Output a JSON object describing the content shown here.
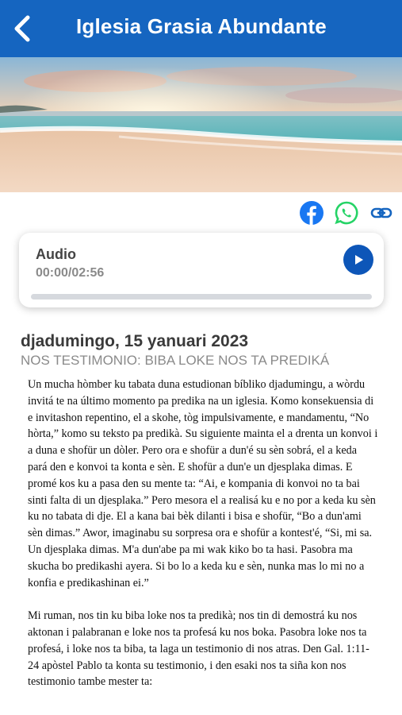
{
  "header": {
    "title": "Iglesia Grasia Abundante",
    "back_icon": "chevron-left-icon"
  },
  "share": {
    "icons": [
      "facebook-icon",
      "whatsapp-icon",
      "link-icon"
    ]
  },
  "audio": {
    "label": "Audio",
    "time": "00:00/02:56",
    "progress": 0
  },
  "devotional": {
    "date": "djadumingo, 15 yanuari 2023",
    "title": "NOS TESTIMONIO: BIBA LOKE NOS TA PREDIKÁ",
    "paragraphs": [
      "Un mucha hòmber ku tabata duna estudionan bíbliko djadumingu, a wòrdu invitá te na último momento pa predika na un iglesia. Komo konsekuensia di e invitashon repentino, el a skohe, tòg impulsivamente, e mandamentu, “No hòrta,” komo su teksto pa predikà. Su siguiente mainta el a drenta un konvoi i a duna e shofür un dòler. Pero ora e shofür a dun'é su sèn sobrá, el a keda pará den e konvoi ta konta e sèn. E shofür a dun'e un djesplaka dimas. E promé kos ku a pasa den su mente ta: “Ai, e kompania di konvoi no ta bai sinti falta di un djesplaka.” Pero mesora el a realisá ku e no por a keda ku sèn ku no tabata di dje. El a kana bai bèk dilanti i bisa e shofür, “Bo a dun'ami sèn dimas.” Awor, imaginabu su sorpresa ora e shofür a kontest'é, “Si, mi sa. Un djesplaka dimas. M'a dun'abe pa mi wak kiko bo ta hasi. Pasobra ma skucha bo predikashi ayera. Si bo lo a keda ku e sèn, nunka mas lo mi no a konfia e predikashinan ei.”",
      "Mi ruman, nos tin ku biba loke nos ta predikà; nos tin di demostrá ku nos aktonan i palabranan e loke nos ta profesá ku nos boka. Pasobra loke nos ta profesá, i loke nos ta biba, ta laga un testimonio di nos atras. Den Gal. 1:11-24 apòstel Pablo ta konta su testimonio, i den esaki nos ta siña kon nos testimonio tambe mester ta:"
    ]
  },
  "colors": {
    "primary": "#1565c0",
    "play": "#0d56b8",
    "facebook": "#1877f2",
    "whatsapp": "#25d366",
    "link": "#1565c0"
  }
}
